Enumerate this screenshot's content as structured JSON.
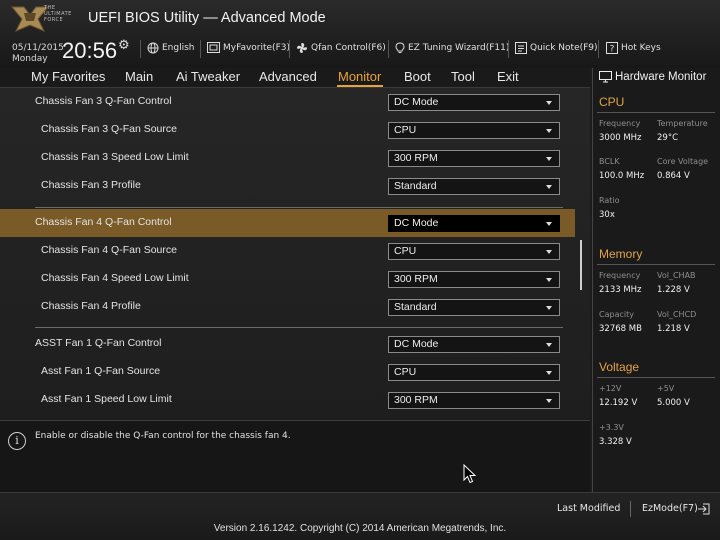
{
  "header": {
    "logo_lines": [
      "THE",
      "ULTIMATE",
      "FORCE"
    ],
    "title": "UEFI BIOS Utility — Advanced Mode",
    "date": "05/11/2015",
    "day": "Monday",
    "time": "20:56",
    "toolbar": [
      {
        "label": "English",
        "icon": "globe-icon"
      },
      {
        "label": "MyFavorite(F3)",
        "icon": "favorite-icon"
      },
      {
        "label": "Qfan Control(F6)",
        "icon": "fan-icon"
      },
      {
        "label": "EZ Tuning Wizard(F11)",
        "icon": "lightbulb-icon"
      },
      {
        "label": "Quick Note(F9)",
        "icon": "note-icon"
      },
      {
        "label": "Hot Keys",
        "icon": "help-icon"
      }
    ]
  },
  "tabs": [
    "My Favorites",
    "Main",
    "Ai Tweaker",
    "Advanced",
    "Monitor",
    "Boot",
    "Tool",
    "Exit"
  ],
  "active_tab": "Monitor",
  "settings": [
    {
      "label": "Chassis Fan 3 Q-Fan Control",
      "value": "DC Mode"
    },
    {
      "label": "Chassis Fan 3 Q-Fan Source",
      "value": "CPU"
    },
    {
      "label": "Chassis Fan 3 Speed Low Limit",
      "value": "300 RPM"
    },
    {
      "label": "Chassis Fan 3 Profile",
      "value": "Standard"
    },
    {
      "label": "Chassis Fan 4 Q-Fan Control",
      "value": "DC Mode"
    },
    {
      "label": "Chassis Fan 4 Q-Fan Source",
      "value": "CPU"
    },
    {
      "label": "Chassis Fan 4 Speed Low Limit",
      "value": "300 RPM"
    },
    {
      "label": "Chassis Fan 4 Profile",
      "value": "Standard"
    },
    {
      "label": "ASST Fan 1 Q-Fan Control",
      "value": "DC Mode"
    },
    {
      "label": "Asst Fan 1 Q-Fan Source",
      "value": "CPU"
    },
    {
      "label": "Asst Fan 1 Speed Low Limit",
      "value": "300 RPM"
    }
  ],
  "help_text": "Enable or disable the Q-Fan control for the chassis fan 4.",
  "hardware_monitor": {
    "title": "Hardware Monitor",
    "cpu": {
      "heading": "CPU",
      "frequency_label": "Frequency",
      "frequency": "3000 MHz",
      "temperature_label": "Temperature",
      "temperature": "29°C",
      "bclk_label": "BCLK",
      "bclk": "100.0 MHz",
      "core_voltage_label": "Core Voltage",
      "core_voltage": "0.864 V",
      "ratio_label": "Ratio",
      "ratio": "30x"
    },
    "memory": {
      "heading": "Memory",
      "frequency_label": "Frequency",
      "frequency": "2133 MHz",
      "vol_chab_label": "Vol_CHAB",
      "vol_chab": "1.228 V",
      "capacity_label": "Capacity",
      "capacity": "32768 MB",
      "vol_chcd_label": "Vol_CHCD",
      "vol_chcd": "1.218 V"
    },
    "voltage": {
      "heading": "Voltage",
      "v12_label": "+12V",
      "v12": "12.192 V",
      "v5_label": "+5V",
      "v5": "5.000 V",
      "v33_label": "+3.3V",
      "v33": "3.328 V"
    }
  },
  "footer": {
    "last_modified": "Last Modified",
    "ezmode": "EzMode(F7)",
    "copyright": "Version 2.16.1242. Copyright (C) 2014 American Megatrends, Inc."
  },
  "colors": {
    "accent": "#e7a33a",
    "highlight_row": "#7a5a26",
    "section_heading": "#e2a24a"
  }
}
